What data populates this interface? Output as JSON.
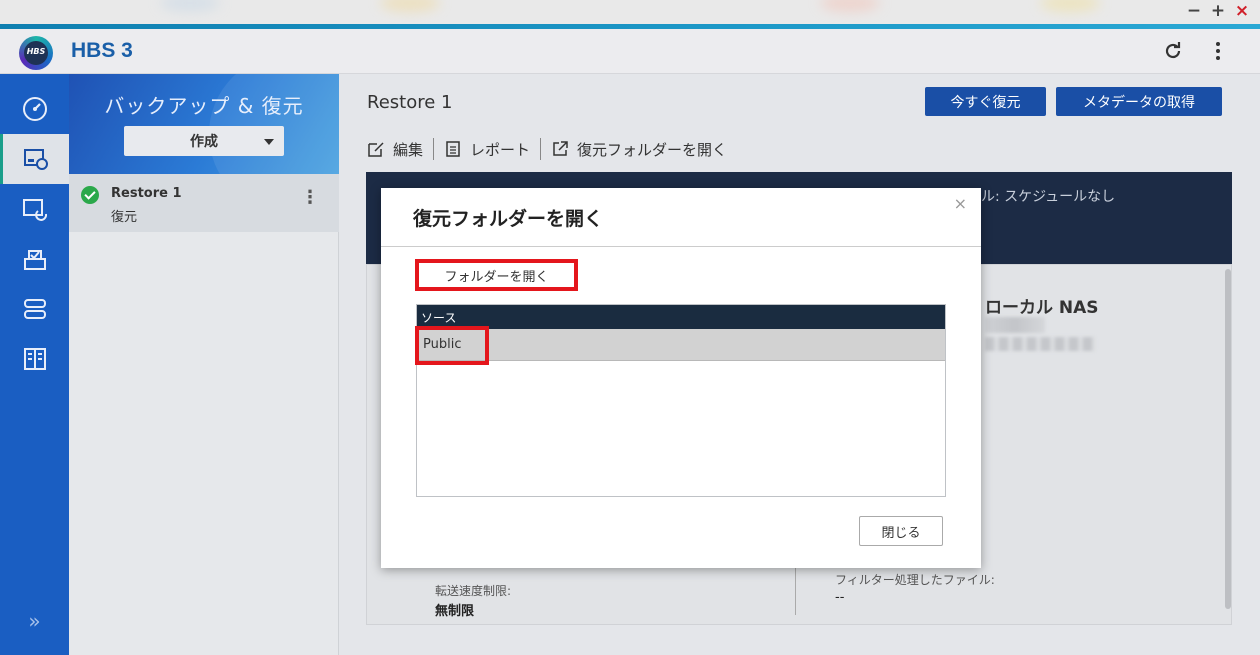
{
  "window": {
    "minimize": "−",
    "maximize": "+",
    "close": "×"
  },
  "app": {
    "logo_text": "HBS",
    "title": "HBS 3"
  },
  "header": {
    "refresh_icon": "refresh-icon",
    "more_icon": "more-vertical-icon"
  },
  "rail": {
    "items": [
      {
        "icon": "dashboard-icon",
        "active": false
      },
      {
        "icon": "backup-restore-icon",
        "active": true
      },
      {
        "icon": "sync-icon",
        "active": false
      },
      {
        "icon": "services-icon",
        "active": false
      },
      {
        "icon": "storage-space-icon",
        "active": false
      },
      {
        "icon": "logs-icon",
        "active": false
      }
    ],
    "expand_label": "»"
  },
  "job_panel": {
    "title": "バックアップ & 復元",
    "create_label": "作成",
    "jobs": [
      {
        "name": "Restore 1",
        "type": "復元",
        "status": "ok"
      }
    ]
  },
  "main": {
    "title": "Restore 1",
    "buttons": {
      "restore_now": "今すぐ復元",
      "get_metadata": "メタデータの取得"
    },
    "toolbar": {
      "edit": "編集",
      "report": "レポート",
      "open_restore_folder": "復元フォルダーを開く"
    },
    "schedule_text": "ル: スケジュールなし",
    "destination_title": "ローカル NAS",
    "transfer_limit_label": "転送速度制限:",
    "transfer_limit_value": "無制限",
    "filtered_files_label": "フィルター処理したファイル:",
    "filtered_files_value": "--"
  },
  "modal": {
    "title": "復元フォルダーを開く",
    "close_x": "×",
    "open_folder_button": "フォルダーを開く",
    "table_header": "ソース",
    "rows": [
      "Public"
    ],
    "close_button": "閉じる"
  },
  "colors": {
    "accent_blue": "#1a4fa6",
    "rail_blue": "#1a5ec2",
    "highlight_red": "#e4161c",
    "dark_header": "#1c2b45"
  }
}
